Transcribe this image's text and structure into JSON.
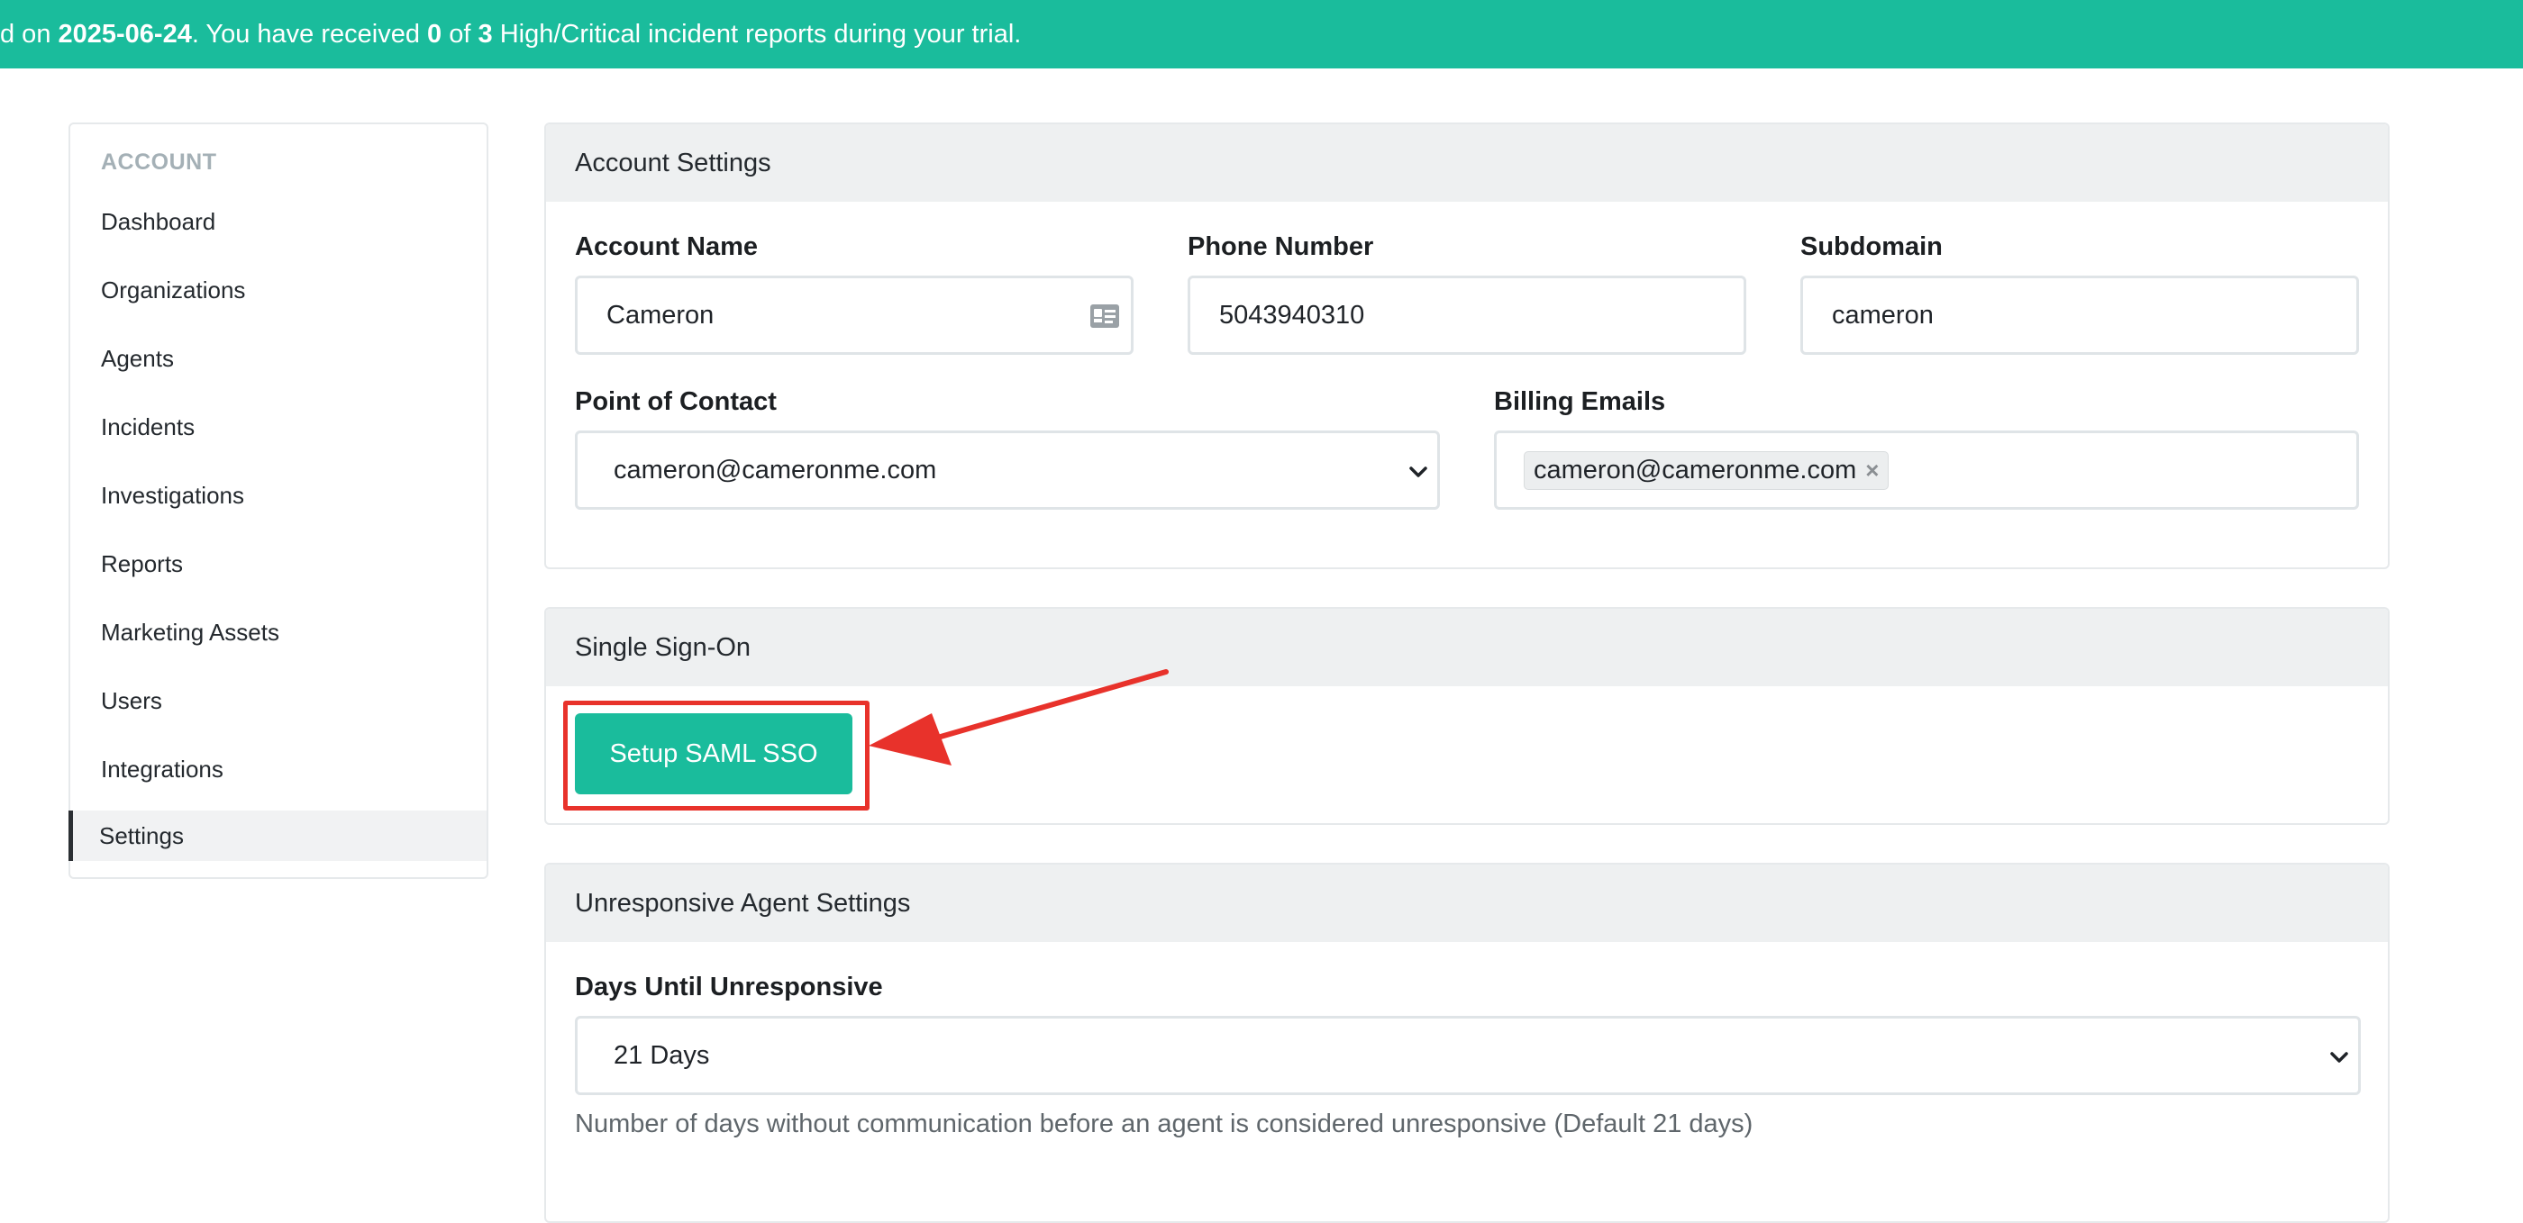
{
  "banner": {
    "prefix": "d on ",
    "date": "2025-06-24",
    "middle": ". You have received ",
    "received": "0",
    "of": " of ",
    "total": "3",
    "suffix": " High/Critical incident reports during your trial."
  },
  "sidebar": {
    "heading": "ACCOUNT",
    "items": [
      {
        "label": "Dashboard"
      },
      {
        "label": "Organizations"
      },
      {
        "label": "Agents"
      },
      {
        "label": "Incidents"
      },
      {
        "label": "Investigations"
      },
      {
        "label": "Reports"
      },
      {
        "label": "Marketing Assets"
      },
      {
        "label": "Users"
      },
      {
        "label": "Integrations"
      },
      {
        "label": "Settings"
      }
    ],
    "active": "Settings"
  },
  "account_settings": {
    "title": "Account Settings",
    "account_name": {
      "label": "Account Name",
      "value": "Cameron"
    },
    "phone_number": {
      "label": "Phone Number",
      "value": "5043940310"
    },
    "subdomain": {
      "label": "Subdomain",
      "value": "cameron"
    },
    "point_of_contact": {
      "label": "Point of Contact",
      "value": "cameron@cameronme.com"
    },
    "billing_emails": {
      "label": "Billing Emails",
      "tags": [
        "cameron@cameronme.com"
      ],
      "remove_symbol": "×"
    }
  },
  "sso": {
    "title": "Single Sign-On",
    "button_label": "Setup SAML SSO"
  },
  "unresponsive": {
    "title": "Unresponsive Agent Settings",
    "days": {
      "label": "Days Until Unresponsive",
      "value": "21 Days"
    },
    "help": "Number of days without communication before an agent is considered unresponsive (Default 21 days)"
  },
  "colors": {
    "accent": "#1abc9c",
    "annotation": "#e8322b"
  },
  "icons": [
    "id-card-icon",
    "chevron-down-icon",
    "close-icon",
    "arrow-annotation-icon"
  ]
}
